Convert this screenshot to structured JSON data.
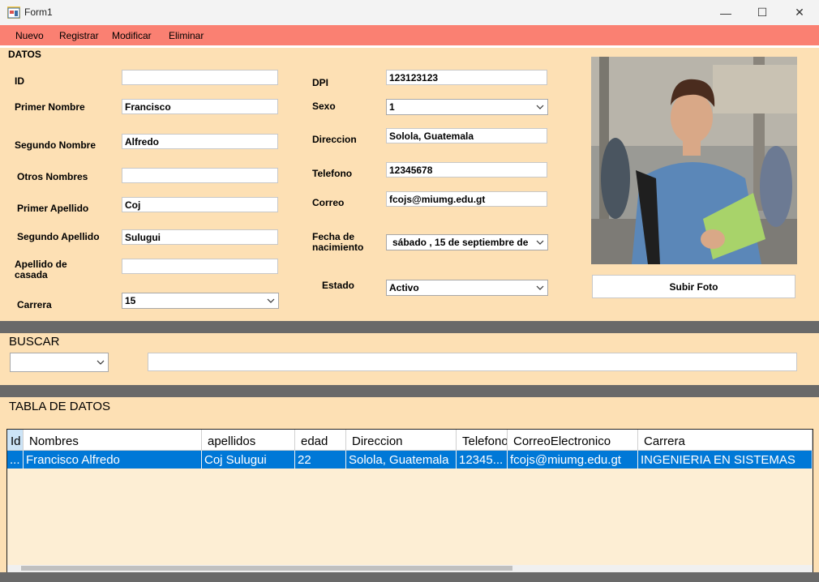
{
  "window": {
    "title": "Form1",
    "minimize_glyph": "—",
    "maximize_glyph": "☐",
    "close_glyph": "✕"
  },
  "menu": {
    "items": [
      "Nuevo",
      "Registrar",
      "Modificar",
      "Eliminar"
    ],
    "color": "#fa8072"
  },
  "datos": {
    "title": "DATOS",
    "labels": {
      "id": "ID",
      "primer_nombre": "Primer Nombre",
      "segundo_nombre": "Segundo Nombre",
      "otros_nombres": "Otros Nombres",
      "primer_apellido": "Primer Apellido",
      "segundo_apellido": "Segundo Apellido",
      "apellido_casada_1": "Apellido de",
      "apellido_casada_2": "casada",
      "carrera": "Carrera",
      "dpi": "DPI",
      "sexo": "Sexo",
      "direccion": "Direccion",
      "telefono": "Telefono",
      "correo": "Correo",
      "fecha_1": "Fecha de",
      "fecha_2": "nacimiento",
      "estado": "Estado"
    },
    "values": {
      "id": "",
      "primer_nombre": "Francisco",
      "segundo_nombre": "Alfredo",
      "otros_nombres": "",
      "primer_apellido": "Coj",
      "segundo_apellido": "Sulugui",
      "apellido_casada": "",
      "carrera": "15",
      "dpi": "123123123",
      "sexo": "1",
      "direccion": "Solola, Guatemala",
      "telefono": "12345678",
      "correo": "fcojs@miumg.edu.gt",
      "fecha_nacimiento": "sábado  , 15 de septiembre de",
      "estado": "Activo"
    },
    "upload_button": "Subir Foto"
  },
  "buscar": {
    "title": "BUSCAR",
    "filter_value": "",
    "search_value": ""
  },
  "tabla": {
    "title": "TABLA DE DATOS",
    "columns": [
      "Id",
      "Nombres",
      "apellidos",
      "edad",
      "Direccion",
      "Telefono",
      "CorreoElectronico",
      "Carrera"
    ],
    "rows": [
      [
        "...",
        "Francisco Alfredo",
        "Coj Sulugui",
        "22",
        "Solola, Guatemala",
        "12345...",
        "fcojs@miumg.edu.gt",
        "INGENIERIA EN SISTEMAS"
      ]
    ],
    "selection_color": "#0078d7"
  },
  "colors": {
    "panel": "#fde0b4",
    "divider": "#696969",
    "grid_bg": "#fdeed4"
  }
}
